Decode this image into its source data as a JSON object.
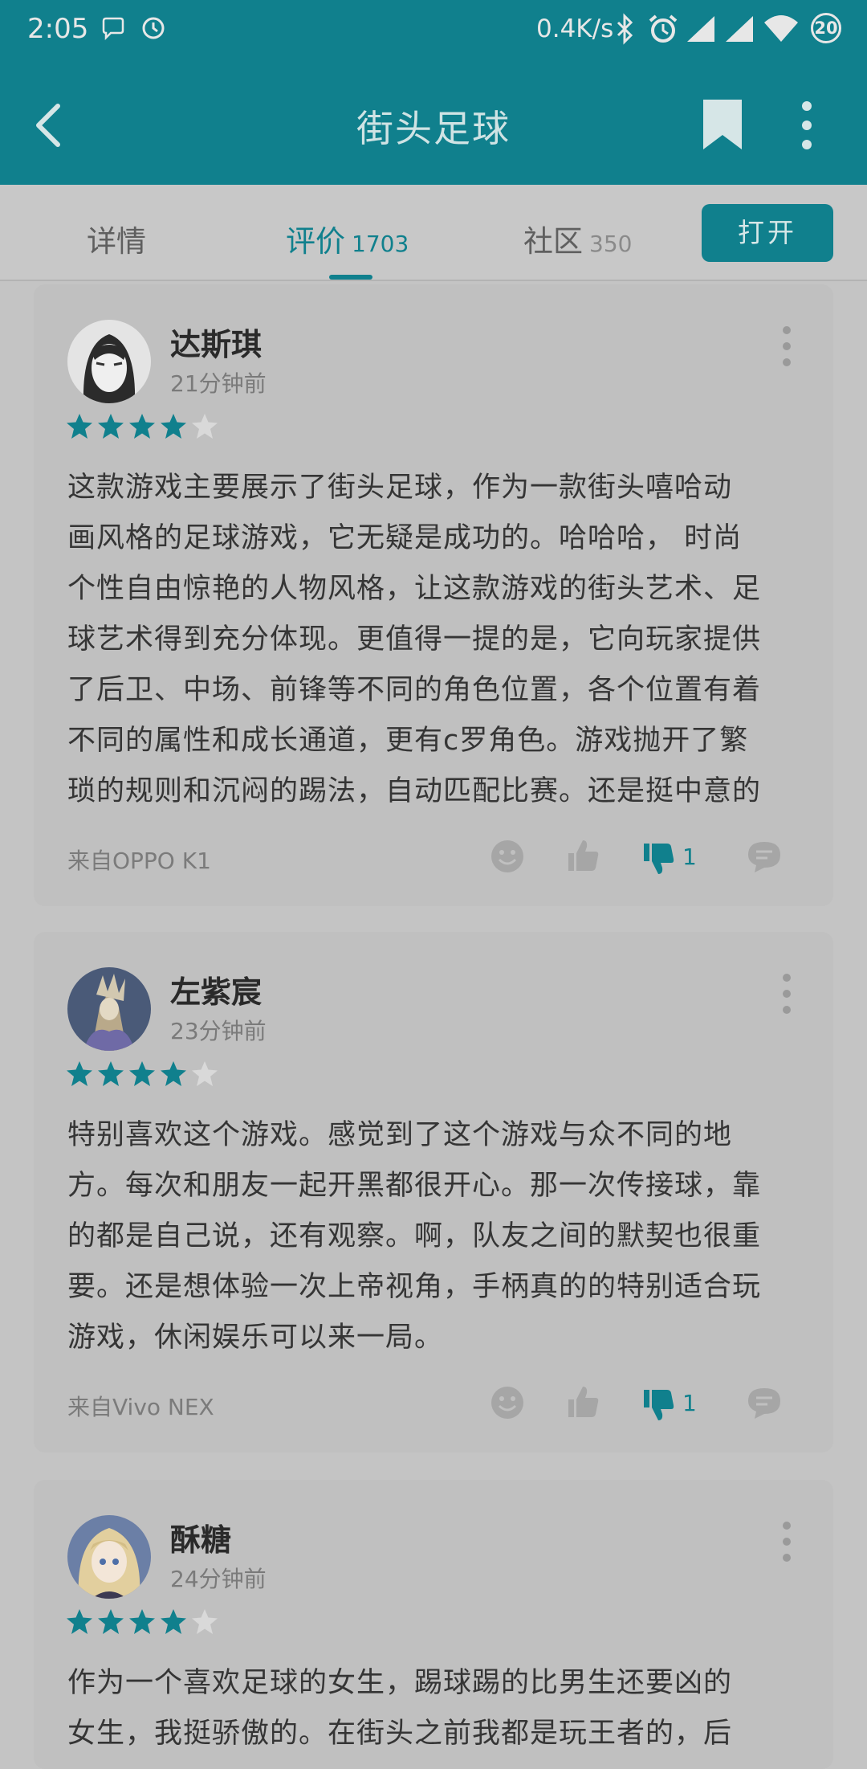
{
  "status_bar": {
    "time": "2:05",
    "net_speed": "0.4K/s",
    "battery": "20"
  },
  "app_bar": {
    "title": "街头足球"
  },
  "tabs": [
    {
      "label": "详情",
      "count": ""
    },
    {
      "label": "评价",
      "count": "1703"
    },
    {
      "label": "社区",
      "count": "350"
    }
  ],
  "open_button": "打开",
  "colors": {
    "accent": "#10808d",
    "star_on": "#10808d",
    "star_off": "#d9d9d9"
  },
  "reviews": [
    {
      "name": "达斯琪",
      "time": "21分钟前",
      "rating": 4,
      "lines": [
        "这款游戏主要展示了街头足球，作为一款街头嘻哈动",
        "画风格的足球游戏，它无疑是成功的。哈哈哈， 时尚",
        "个性自由惊艳的人物风格，让这款游戏的街头艺术、足",
        "球艺术得到充分体现。更值得一提的是，它向玩家提供",
        "了后卫、中场、前锋等不同的角色位置，各个位置有着",
        "不同的属性和成长通道，更有c罗角色。游戏抛开了繁",
        "琐的规则和沉闷的踢法，自动匹配比赛。还是挺中意的"
      ],
      "device": "来自OPPO K1",
      "dislikes": "1"
    },
    {
      "name": "左紫宸",
      "time": "23分钟前",
      "rating": 4,
      "lines": [
        "特别喜欢这个游戏。感觉到了这个游戏与众不同的地",
        "方。每次和朋友一起开黑都很开心。那一次传接球，靠",
        "的都是自己说，还有观察。啊，队友之间的默契也很重",
        "要。还是想体验一次上帝视角，手柄真的的特别适合玩",
        "游戏，休闲娱乐可以来一局。"
      ],
      "device": "来自Vivo NEX",
      "dislikes": "1"
    },
    {
      "name": "酥糖",
      "time": "24分钟前",
      "rating": 4,
      "lines": [
        "作为一个喜欢足球的女生，踢球踢的比男生还要凶的",
        "女生，我挺骄傲的。在街头之前我都是玩王者的，后"
      ],
      "device": "",
      "dislikes": ""
    }
  ]
}
